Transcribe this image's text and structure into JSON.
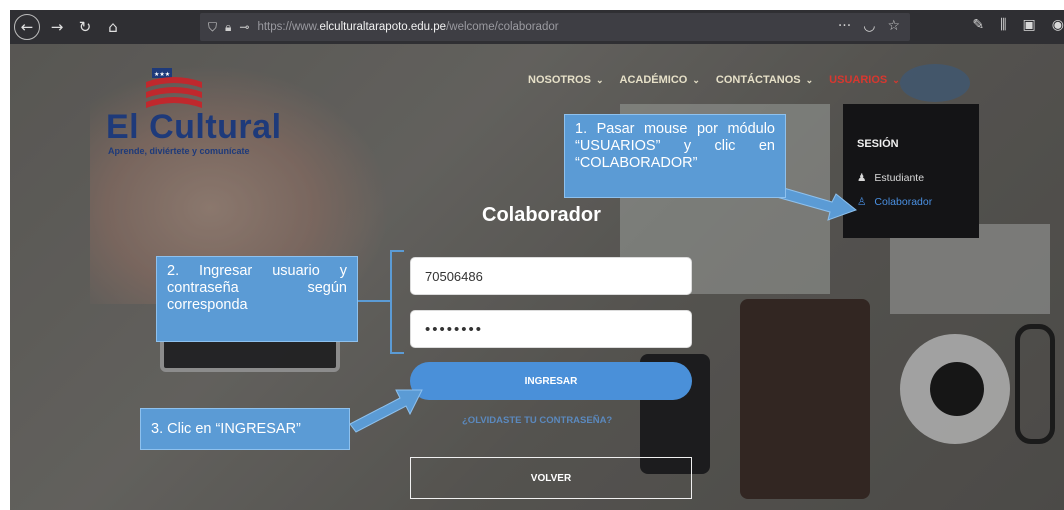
{
  "browser": {
    "url_prefix": "https://www.",
    "url_domain": "elculturaltarapoto.edu.pe",
    "url_path": "/welcome/colaborador",
    "icons": [
      "back-arrow",
      "forward-arrow",
      "reload",
      "home",
      "shield",
      "lock",
      "key",
      "more-dots",
      "pocket",
      "star",
      "wrench",
      "library",
      "sidebar"
    ]
  },
  "logo": {
    "text": "El Cultural",
    "slogan": "Aprende, diviértete y comunícate"
  },
  "nav": {
    "items": [
      {
        "label": "NOSOTROS"
      },
      {
        "label": "ACADÉMICO"
      },
      {
        "label": "CONTÁCTANOS"
      },
      {
        "label": "USUARIOS"
      }
    ]
  },
  "dropdown": {
    "title": "SESIÓN",
    "items": [
      {
        "label": "Estudiante"
      },
      {
        "label": "Colaborador"
      }
    ]
  },
  "form": {
    "title": "Colaborador",
    "user_value": "70506486",
    "password_value": "••••••••",
    "login_label": "INGRESAR",
    "forgot_label": "¿OLVIDASTE TU CONTRASEÑA?",
    "back_label": "VOLVER"
  },
  "callouts": {
    "step1": "1. Pasar mouse por módulo “USUARIOS” y clic en “COLABORADOR”",
    "step2": "2. Ingresar usuario y contraseña según corresponda",
    "step3": "3. Clic en “INGRESAR”"
  },
  "colors": {
    "callout": "#5b9bd5",
    "button": "#4a90d9",
    "active_nav": "#d8372f",
    "logo": "#1e3a7a"
  }
}
